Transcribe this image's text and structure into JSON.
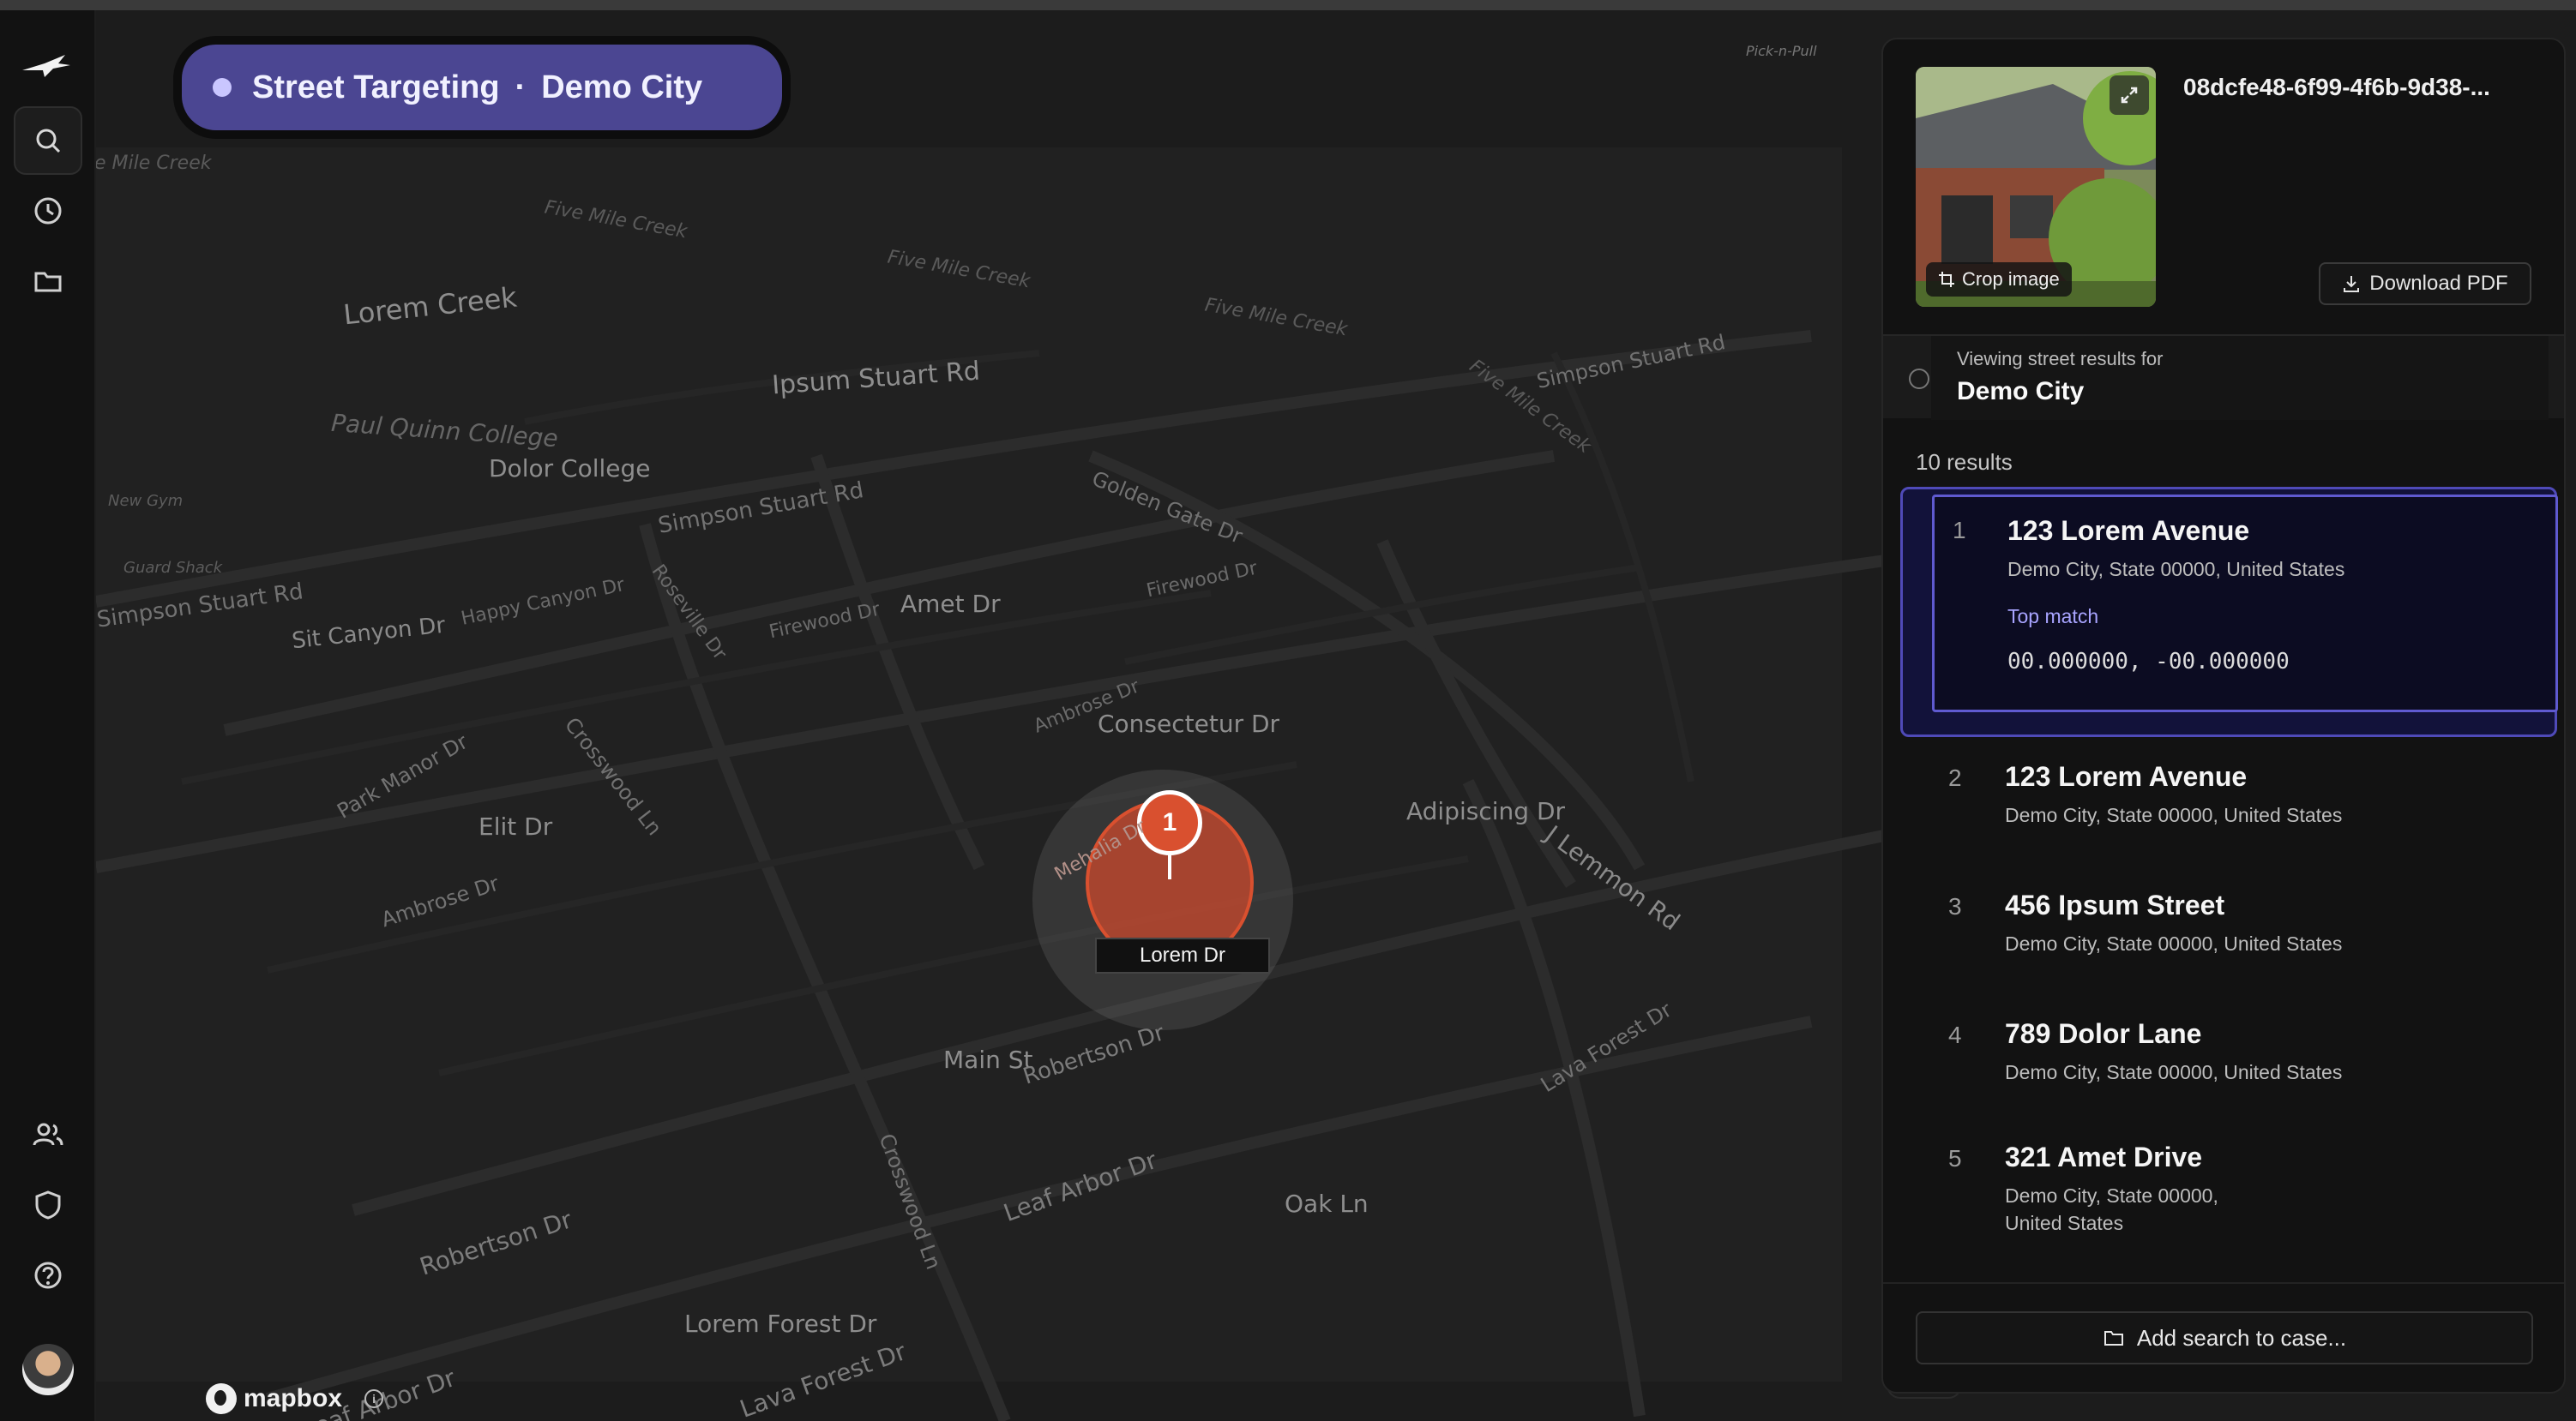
{
  "header": {
    "mode": "Street Targeting",
    "separator": "·",
    "city": "Demo City"
  },
  "sidebar": {
    "items": [
      {
        "icon": "search-icon"
      },
      {
        "icon": "history-icon"
      },
      {
        "icon": "folder-icon"
      },
      {
        "icon": "users-icon"
      },
      {
        "icon": "shield-icon"
      },
      {
        "icon": "help-icon"
      }
    ]
  },
  "map": {
    "labels": {
      "five_mile_creek": "Five Mile Creek",
      "five_mile_creek_edge": "e Mile Creek",
      "lorem_creek": "Lorem Creek",
      "ipsum_stuart": "Ipsum Stuart Rd",
      "paul_quinn": "Paul Quinn College",
      "dolor_college": "Dolor College",
      "new_gym": "New Gym",
      "guard_shack": "Guard Shack",
      "simpson_stuart": "Simpson Stuart Rd",
      "sit_canyon": "Sit Canyon Dr",
      "happy_canyon": "Happy Canyon Dr",
      "roseville": "Roseville Dr",
      "firewood": "Firewood Dr",
      "amet_dr": "Amet Dr",
      "golden_gate": "Golden Gate Dr",
      "ambrose": "Ambrose Dr",
      "consectetur": "Consectetur Dr",
      "park_manor": "Park Manor Dr",
      "crosswood": "Crosswood Ln",
      "elit_dr": "Elit Dr",
      "adipiscing": "Adipiscing Dr",
      "j_lemmon": "J Lemmon Rd",
      "mehalia": "Mehalia Dr",
      "main_st": "Main St",
      "robertson": "Robertson Dr",
      "lava_forest": "Lava Forest Dr",
      "leaf_arbor": "Leaf Arbor Dr",
      "oak_ln": "Oak Ln",
      "lorem_forest": "Lorem Forest Dr",
      "pick_n_pull": "Pick-n-Pull"
    },
    "pin": {
      "rank": "1",
      "label": "Lorem Dr"
    },
    "attribution": {
      "logo_text": "mapbox",
      "info": "i"
    }
  },
  "panel": {
    "image_id": "08dcfe48-6f99-4f6b-9d38-...",
    "crop_label": "Crop image",
    "download_label": "Download PDF",
    "context_key": "Viewing street results for",
    "context_value": "Demo City",
    "result_count": "10 results",
    "results": [
      {
        "rank": "1",
        "name": "123 Lorem Avenue",
        "address": "Demo City, State 00000, United States",
        "badge": "Top match",
        "coords": "00.000000,  -00.000000"
      },
      {
        "rank": "2",
        "name": "123 Lorem Avenue",
        "address": "Demo City, State 00000, United States"
      },
      {
        "rank": "3",
        "name": "456 Ipsum Street",
        "address": "Demo City, State 00000, United States"
      },
      {
        "rank": "4",
        "name": "789 Dolor Lane",
        "address": "Demo City, State 00000, United States"
      },
      {
        "rank": "5",
        "name": "321 Amet Drive",
        "address": "Demo City, State 00000, United States"
      }
    ],
    "add_case_label": "Add search to case..."
  },
  "colors": {
    "accent": "#4b4692",
    "pin": "#d9502f",
    "selection": "#4f4ab8",
    "background": "#151515"
  }
}
